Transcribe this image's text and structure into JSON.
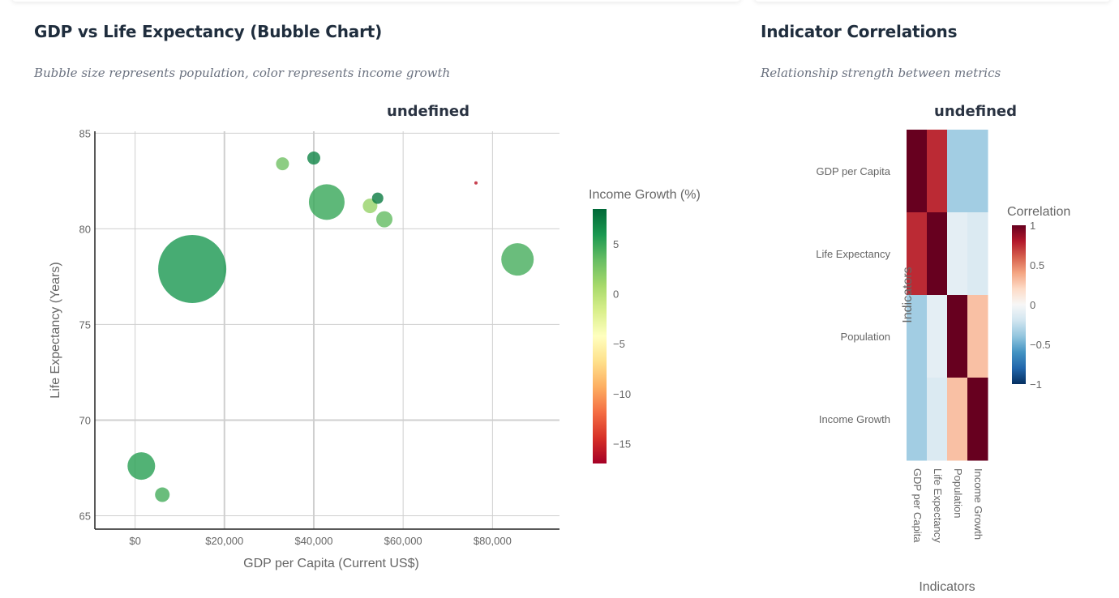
{
  "bubble_panel": {
    "title": "GDP vs Life Expectancy (Bubble Chart)",
    "subtitle": "Bubble size represents population, color represents income growth"
  },
  "heatmap_panel": {
    "title": "Indicator Correlations",
    "subtitle": "Relationship strength between metrics"
  },
  "chart_data": [
    {
      "type": "scatter",
      "title": "undefined",
      "xlabel": "GDP per Capita (Current US$)",
      "ylabel": "Life Expectancy (Years)",
      "xlim": [
        -9000,
        95000
      ],
      "ylim": [
        64.3,
        85.1
      ],
      "x_ticks": [
        0,
        20000,
        40000,
        60000,
        80000
      ],
      "x_tick_labels": [
        "$0",
        "$20,000",
        "$40,000",
        "$60,000",
        "$80,000"
      ],
      "y_ticks": [
        65,
        70,
        75,
        80,
        85
      ],
      "y_tick_labels": [
        "65",
        "70",
        "75",
        "80",
        "85"
      ],
      "grid": true,
      "colorbar": {
        "title": "Income Growth (%)",
        "range": [
          -17,
          8.5
        ],
        "ticks": [
          5,
          0,
          -5,
          -10,
          -15
        ],
        "tick_labels": [
          "5",
          "0",
          "−5",
          "−10",
          "−15"
        ],
        "colorscale": "RdYlGn"
      },
      "points": [
        {
          "x": 1400,
          "y": 67.6,
          "size": 17,
          "growth": 5.5
        },
        {
          "x": 6100,
          "y": 66.1,
          "size": 9,
          "growth": 4.5
        },
        {
          "x": 12800,
          "y": 77.9,
          "size": 42,
          "growth": 6.0
        },
        {
          "x": 33000,
          "y": 83.4,
          "size": 8,
          "growth": 3.0
        },
        {
          "x": 40000,
          "y": 83.7,
          "size": 8,
          "growth": 7.0
        },
        {
          "x": 42900,
          "y": 81.4,
          "size": 22,
          "growth": 5.0
        },
        {
          "x": 52600,
          "y": 81.2,
          "size": 9,
          "growth": 1.5
        },
        {
          "x": 54300,
          "y": 81.6,
          "size": 7,
          "growth": 7.5
        },
        {
          "x": 55800,
          "y": 80.5,
          "size": 10,
          "growth": 3.5
        },
        {
          "x": 76300,
          "y": 82.4,
          "size": 2,
          "growth": -16.0
        },
        {
          "x": 85600,
          "y": 78.4,
          "size": 20,
          "growth": 4.5
        }
      ]
    },
    {
      "type": "heatmap",
      "title": "undefined",
      "xlabel": "Indicators",
      "ylabel": "Indicators",
      "labels": [
        "GDP per Capita",
        "Life Expectancy",
        "Population",
        "Income Growth"
      ],
      "matrix": [
        [
          1.0,
          0.75,
          -0.35,
          -0.35
        ],
        [
          0.75,
          1.0,
          -0.1,
          -0.15
        ],
        [
          -0.35,
          -0.1,
          1.0,
          0.3
        ],
        [
          -0.35,
          -0.15,
          0.3,
          1.0
        ]
      ],
      "colorbar": {
        "title": "Correlation",
        "range": [
          -1,
          1
        ],
        "ticks": [
          1,
          0.5,
          0,
          -0.5,
          -1
        ],
        "tick_labels": [
          "1",
          "0.5",
          "0",
          "−0.5",
          "−1"
        ],
        "colorscale": "RdBu"
      }
    }
  ]
}
